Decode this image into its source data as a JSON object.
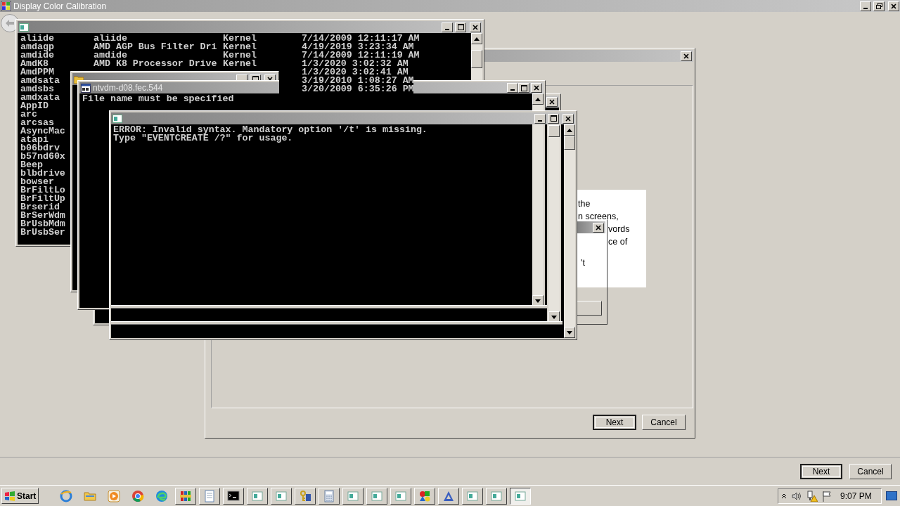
{
  "calibration_window": {
    "title": "Display Color Calibration",
    "buttons": [
      {
        "label": "Next",
        "default": true
      },
      {
        "label": "Cancel",
        "default": false
      }
    ]
  },
  "dialog": {
    "text_lines": [
      "the",
      "n screens,",
      "vords",
      "ce of",
      "'t"
    ],
    "buttons": [
      {
        "label": "Next",
        "default": true
      },
      {
        "label": "Cancel",
        "default": false
      }
    ]
  },
  "services_console": {
    "rows": [
      {
        "name": "aliide",
        "description": "aliide",
        "type": "Kernel",
        "date": "7/14/2009 12:11:17 AM"
      },
      {
        "name": "amdagp",
        "description": "AMD AGP Bus Filter Dri",
        "type": "Kernel",
        "date": "4/19/2019 3:23:34 AM"
      },
      {
        "name": "amdide",
        "description": "amdide",
        "type": "Kernel",
        "date": "7/14/2009 12:11:19 AM"
      },
      {
        "name": "AmdK8",
        "description": "AMD K8 Processor Drive",
        "type": "Kernel",
        "date": "1/3/2020 3:02:32 AM"
      },
      {
        "name": "AmdPPM",
        "date": "1/3/2020 3:02:41 AM"
      },
      {
        "name": "amdsata",
        "date": "3/19/2010 1:08:27 AM"
      },
      {
        "name": "amdsbs",
        "date": "3/20/2009 6:35:26 PM"
      },
      {
        "name": "amdxata"
      },
      {
        "name": "AppID"
      },
      {
        "name": "arc"
      },
      {
        "name": "arcsas"
      },
      {
        "name": "AsyncMac"
      },
      {
        "name": "atapi"
      },
      {
        "name": "b06bdrv"
      },
      {
        "name": "b57nd60x"
      },
      {
        "name": "Beep"
      },
      {
        "name": "blbdrive"
      },
      {
        "name": "bowser"
      },
      {
        "name": "BrFiltLo"
      },
      {
        "name": "BrFiltUp"
      },
      {
        "name": "Brserid"
      },
      {
        "name": "BrSerWdm"
      },
      {
        "name": "BrUsbMdm"
      },
      {
        "name": "BrUsbSer"
      }
    ]
  },
  "ntvdm_console": {
    "title": "ntvdm-d08.fec.544",
    "output": [
      "File name must be specified"
    ]
  },
  "eventcreate_console": {
    "output": [
      "ERROR: Invalid syntax. Mandatory option '/t' is missing.",
      "Type \"EVENTCREATE /?\" for usage."
    ]
  },
  "taskbar": {
    "start": "Start",
    "pinned": [
      {
        "kind": "globe"
      },
      {
        "kind": "folder"
      },
      {
        "kind": "play"
      },
      {
        "kind": "ring"
      },
      {
        "kind": "swirl"
      }
    ],
    "buttons": [
      {
        "kind": "books",
        "selected": false
      },
      {
        "kind": "notepad",
        "selected": false
      },
      {
        "kind": "terminal",
        "selected": false
      },
      {
        "kind": "window",
        "selected": false
      },
      {
        "kind": "window",
        "selected": false
      },
      {
        "kind": "keys",
        "selected": false
      },
      {
        "kind": "calculator",
        "selected": false
      },
      {
        "kind": "window",
        "selected": false
      },
      {
        "kind": "window",
        "selected": false
      },
      {
        "kind": "window",
        "selected": false
      },
      {
        "kind": "shapes",
        "selected": false
      },
      {
        "kind": "triangle",
        "selected": false
      },
      {
        "kind": "window",
        "selected": false
      },
      {
        "kind": "window",
        "selected": false
      },
      {
        "kind": "window",
        "selected": true
      }
    ],
    "clock": "9:07 PM"
  }
}
